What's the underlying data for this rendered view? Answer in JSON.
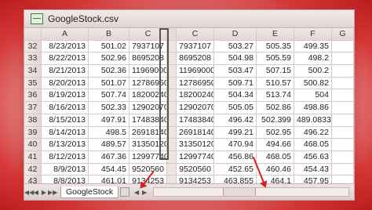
{
  "window": {
    "title": "GoogleStock.csv"
  },
  "columns": [
    "A",
    "B",
    "C",
    "C",
    "D",
    "E",
    "F",
    "G"
  ],
  "rows": [
    {
      "num": "32",
      "A": "8/23/2013",
      "B": "501.02",
      "C1": "7937107",
      "C2": "7937107",
      "D": "503.27",
      "E": "505.35",
      "F": "499.35"
    },
    {
      "num": "33",
      "A": "8/22/2013",
      "B": "502.96",
      "C1": "8695208",
      "C2": "8695208",
      "D": "504.98",
      "E": "505.59",
      "F": "498.2"
    },
    {
      "num": "34",
      "A": "8/21/2013",
      "B": "502.36",
      "C1": "11969000",
      "C2": "11969000",
      "D": "503.47",
      "E": "507.15",
      "F": "500.2"
    },
    {
      "num": "35",
      "A": "8/20/2013",
      "B": "501.07",
      "C1": "12786950",
      "C2": "12786950",
      "D": "509.71",
      "E": "510.57",
      "F": "500.82"
    },
    {
      "num": "36",
      "A": "8/19/2013",
      "B": "507.74",
      "C1": "18200240",
      "C2": "18200240",
      "D": "504.34",
      "E": "513.74",
      "F": "504"
    },
    {
      "num": "37",
      "A": "8/16/2013",
      "B": "502.33",
      "C1": "12902070",
      "C2": "12902070",
      "D": "505.05",
      "E": "502.86",
      "F": "498.86"
    },
    {
      "num": "38",
      "A": "8/15/2013",
      "B": "497.91",
      "C1": "17483840",
      "C2": "17483840",
      "D": "496.42",
      "E": "502.399",
      "F": "489.0833"
    },
    {
      "num": "39",
      "A": "8/14/2013",
      "B": "498.5",
      "C1": "26918140",
      "C2": "26918140",
      "D": "499.21",
      "E": "502.95",
      "F": "496.22"
    },
    {
      "num": "40",
      "A": "8/13/2013",
      "B": "489.57",
      "C1": "31350120",
      "C2": "31350120",
      "D": "470.94",
      "E": "494.66",
      "F": "468.05"
    },
    {
      "num": "41",
      "A": "8/12/2013",
      "B": "467.36",
      "C1": "12997740",
      "C2": "12997740",
      "D": "456.86",
      "E": "468.05",
      "F": "456.63"
    },
    {
      "num": "42",
      "A": "8/9/2013",
      "B": "454.45",
      "C1": "9520560",
      "C2": "9520560",
      "D": "452.65",
      "E": "460.46",
      "F": "454.43"
    },
    {
      "num": "43",
      "A": "8/8/2013",
      "B": "461.01",
      "C1": "9134253",
      "C2": "9134253",
      "D": "463.855",
      "E": "464.1",
      "F": "457.95"
    }
  ],
  "statusbar": {
    "sheet_tab": "GoogleStock"
  },
  "colors": {
    "arrow": "#d42020",
    "vignette": "#d63a3a"
  }
}
